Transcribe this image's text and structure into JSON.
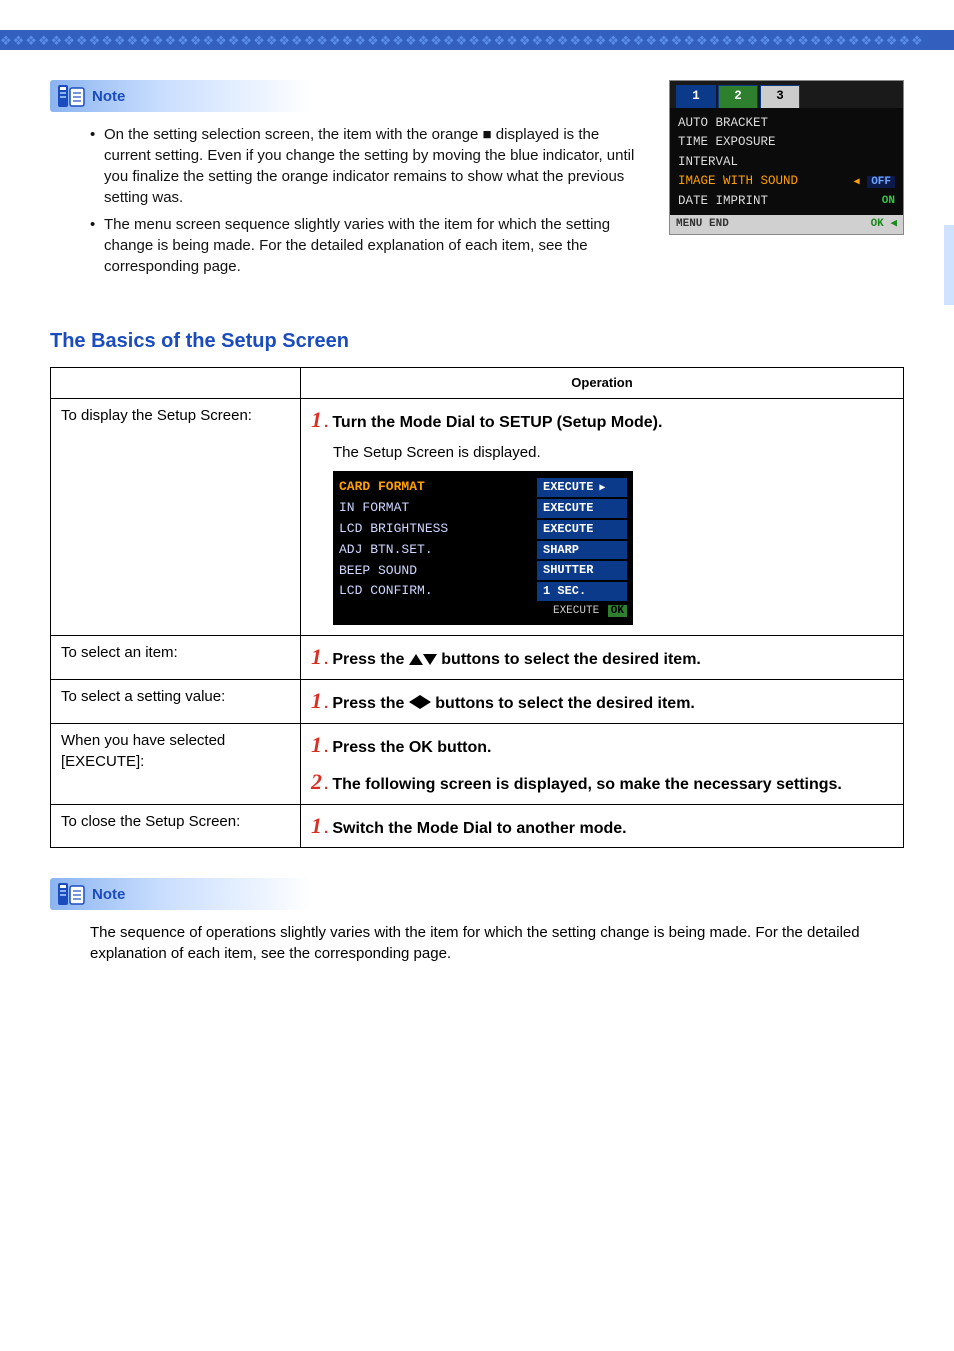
{
  "note_label": "Note",
  "note1_items": [
    "On the setting selection screen, the item with the orange ■ displayed is the current setting. Even if you change the setting by moving the blue indicator, until you finalize the setting the orange indicator remains to show what the previous setting was.",
    "The menu screen sequence slightly varies with the item for which the setting change is being made. For the detailed explanation of each item, see the corresponding page."
  ],
  "side_menu": {
    "tabs": [
      "1",
      "2",
      "3"
    ],
    "rows": [
      {
        "label": "AUTO BRACKET",
        "val": ""
      },
      {
        "label": "TIME EXPOSURE",
        "val": ""
      },
      {
        "label": "INTERVAL",
        "val": ""
      },
      {
        "label": "IMAGE WITH SOUND",
        "val": "OFF",
        "hl": true
      },
      {
        "label": "DATE IMPRINT",
        "val": "ON"
      }
    ],
    "footer_left": "MENU END",
    "footer_right": "OK ◀"
  },
  "section_title": "The Basics of the Setup Screen",
  "table": {
    "op_header": "Operation",
    "row1": {
      "left": "To display the Setup Screen:",
      "step1": "Turn the Mode Dial to SETUP (Setup Mode).",
      "sub": "The Setup Screen is displayed.",
      "lcd": [
        {
          "label": "CARD FORMAT",
          "val": "EXECUTE",
          "hl": true,
          "play": true
        },
        {
          "label": "IN FORMAT",
          "val": "EXECUTE"
        },
        {
          "label": "LCD BRIGHTNESS",
          "val": "EXECUTE"
        },
        {
          "label": "ADJ BTN.SET.",
          "val": "SHARP"
        },
        {
          "label": "BEEP SOUND",
          "val": "SHUTTER"
        },
        {
          "label": "LCD CONFIRM.",
          "val": "1 SEC."
        }
      ],
      "lcd_footer": "EXECUTE"
    },
    "row2": {
      "left": "To select an item:",
      "text_a": "Press the ",
      "text_b": " buttons to select the desired item."
    },
    "row3": {
      "left": "To select a setting value:",
      "text_a": "Press the ",
      "text_b": " buttons to select the desired item."
    },
    "row4": {
      "left": "When you have selected [EXECUTE]:",
      "s1": "Press the OK button.",
      "s2": "The following screen is displayed,  so make the necessary settings."
    },
    "row5": {
      "left": "To close the Setup Screen:",
      "s1": "Switch the Mode Dial to another mode."
    }
  },
  "note2_text": "The sequence of operations slightly varies with the item for which the setting change is being made. For the detailed explanation of each item, see the corresponding page."
}
